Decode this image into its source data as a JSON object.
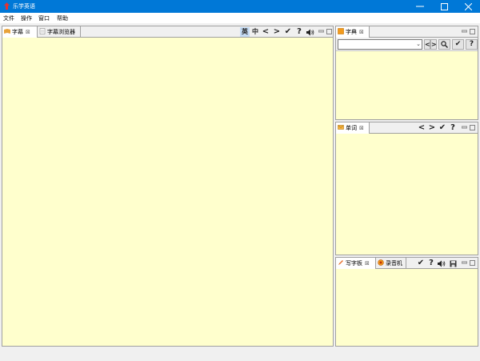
{
  "window": {
    "title": "乐学英语",
    "controls": {
      "minimize": "—",
      "maximize": "☐",
      "close": "✕"
    },
    "accent": "#0078d7"
  },
  "menu": [
    "文件",
    "操作",
    "窗口",
    "帮助"
  ],
  "panels": {
    "subtitle": {
      "tabs": [
        {
          "label": "字幕",
          "icon": "book-icon",
          "active": true
        },
        {
          "label": "字幕浏览器",
          "icon": "document-icon",
          "active": false
        }
      ],
      "tools": [
        "英",
        "中",
        "<",
        ">",
        "✔",
        "?",
        "speaker-icon"
      ]
    },
    "dictionary": {
      "tab": {
        "label": "字典",
        "icon": "dictionary-icon"
      },
      "combo_value": "",
      "buttons": [
        "<",
        ">",
        "search-icon",
        "✔",
        "?"
      ]
    },
    "words": {
      "tab": {
        "label": "单词",
        "icon": "envelope-icon"
      },
      "tools": [
        "<",
        ">",
        "✔",
        "?"
      ]
    },
    "writing": {
      "tabs": [
        {
          "label": "写字板",
          "icon": "pencil-icon",
          "active": true
        },
        {
          "label": "录音机",
          "icon": "record-icon",
          "active": false
        }
      ],
      "tools": [
        "✔",
        "?",
        "speaker-icon",
        "save-icon"
      ]
    }
  },
  "colors": {
    "panel_bg": "#ffffcd",
    "chrome_bg": "#f0f0f0"
  }
}
